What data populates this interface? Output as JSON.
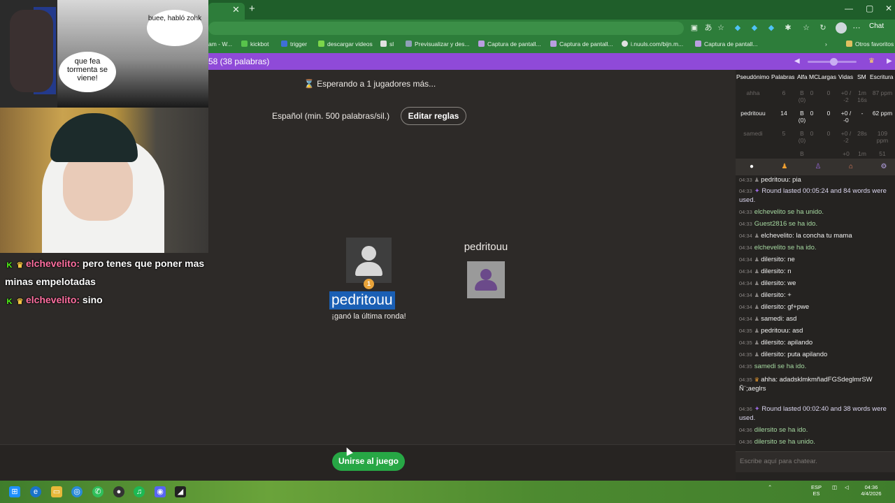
{
  "browser": {
    "bookmarks": [
      "am - W...",
      "kickbot",
      "trigger",
      "descargar videos",
      "sl",
      "Previsualizar y des...",
      "Captura de pantall...",
      "Captura de pantall...",
      "i.nuuls.com/bijn.m...",
      "Captura de pantall...",
      "Otros favoritos"
    ],
    "chat_button": "Chat"
  },
  "game": {
    "header_text": "58 (38 palabras)",
    "status": "Esperando a 1 jugadores más...",
    "rules": "Español (min. 500 palabras/sil.)",
    "edit_rules_label": "Editar reglas",
    "winner_name": "pedritouu",
    "winner_rank": "1",
    "winner_note": "¡ganó la última ronda!",
    "opponent_name": "pedritouu",
    "join_label": "Unirse al juego"
  },
  "scoreboard": {
    "headers": [
      "Pseudónimo",
      "Palabras",
      "Alfa",
      "MC",
      "Largas",
      "Vidas",
      "SM",
      "Escritura"
    ],
    "rows": [
      {
        "name": "ahha",
        "words": "6",
        "alfa": "B (0)",
        "mc": "0",
        "largas": "0",
        "vidas": "+0 / -2",
        "sm": "1m 16s",
        "escritura": "87 ppm",
        "dim": true
      },
      {
        "name": "pedritouu",
        "words": "14",
        "alfa": "B (0)",
        "mc": "0",
        "largas": "0",
        "vidas": "+0 / -0",
        "sm": "-",
        "escritura": "62 ppm",
        "dim": false
      },
      {
        "name": "samedi",
        "words": "5",
        "alfa": "B (0)",
        "mc": "0",
        "largas": "0",
        "vidas": "+0 / -2",
        "sm": "28s",
        "escritura": "109 ppm",
        "dim": true
      },
      {
        "name": "",
        "words": "",
        "alfa": "B",
        "mc": "",
        "largas": "",
        "vidas": "+0",
        "sm": "1m",
        "escritura": "51",
        "dim": true
      }
    ]
  },
  "chat": {
    "messages": [
      {
        "time": "04:33",
        "user": "pedritouu",
        "text": "pia",
        "kind": "user"
      },
      {
        "time": "04:33",
        "user": "",
        "text": "Round lasted 00:05:24 and 84 words were used.",
        "kind": "round"
      },
      {
        "time": "04:33",
        "user": "",
        "text": "elchevelito se ha unido.",
        "kind": "sys"
      },
      {
        "time": "04:33",
        "user": "",
        "text": "Guest2816 se ha ido.",
        "kind": "sys"
      },
      {
        "time": "04:34",
        "user": "elchevelito",
        "text": "la concha tu mama",
        "kind": "user"
      },
      {
        "time": "04:34",
        "user": "",
        "text": "elchevelito se ha ido.",
        "kind": "sys"
      },
      {
        "time": "04:34",
        "user": "dilersito",
        "text": "ne",
        "kind": "user"
      },
      {
        "time": "04:34",
        "user": "dilersito",
        "text": "n",
        "kind": "user"
      },
      {
        "time": "04:34",
        "user": "dilersito",
        "text": "we",
        "kind": "user"
      },
      {
        "time": "04:34",
        "user": "dilersito",
        "text": "+",
        "kind": "user"
      },
      {
        "time": "04:34",
        "user": "dilersito",
        "text": "gf+pwe",
        "kind": "user"
      },
      {
        "time": "04:34",
        "user": "samedi",
        "text": "asd",
        "kind": "user"
      },
      {
        "time": "04:35",
        "user": "pedritouu",
        "text": "asd",
        "kind": "user"
      },
      {
        "time": "04:35",
        "user": "dilersito",
        "text": "apilando",
        "kind": "user"
      },
      {
        "time": "04:35",
        "user": "dilersito",
        "text": "puta apilando",
        "kind": "user"
      },
      {
        "time": "04:35",
        "user": "",
        "text": "samedi se ha ido.",
        "kind": "sys"
      },
      {
        "time": "04:35",
        "user": "ahha",
        "text": "adadsklmkmñadFGSdeglmrSW Ñ¨;aeglrs",
        "kind": "user"
      },
      {
        "time": "04:36",
        "user": "",
        "text": "Round lasted 00:02:40 and 38 words were used.",
        "kind": "round"
      },
      {
        "time": "04:36",
        "user": "",
        "text": "dilersito se ha ido.",
        "kind": "sys"
      },
      {
        "time": "04:36",
        "user": "",
        "text": "dilersito se ha unido.",
        "kind": "sys"
      }
    ],
    "input_placeholder": "Escribe aquí para chatear."
  },
  "stream_overlay": {
    "bubble_top": "buee, habló zohk",
    "bubble_bottom": "que fea tormenta se viene!",
    "chat": [
      {
        "user": "elchevelito:",
        "text": "pero tenes que poner mas minas empelotadas"
      },
      {
        "user": "elchevelito:",
        "text": "sino"
      }
    ]
  },
  "taskbar": {
    "lang": "ESP",
    "lang_sub": "ES",
    "time": "04:36",
    "date": "4/4/2026"
  },
  "colors": {
    "game_header": "#8f4ad8",
    "join_button": "#27a745",
    "browser_chrome": "#2d7d3a",
    "selection": "#1a5fb4"
  }
}
